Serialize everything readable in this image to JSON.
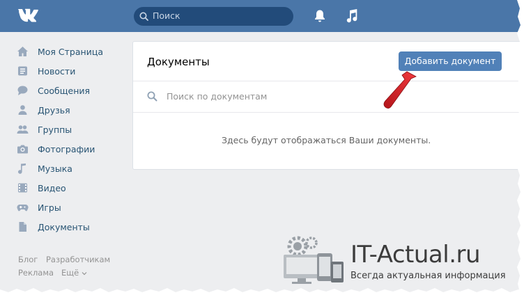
{
  "header": {
    "search_placeholder": "Поиск"
  },
  "sidebar": {
    "items": [
      {
        "label": "Моя Страница",
        "icon": "home-icon"
      },
      {
        "label": "Новости",
        "icon": "news-icon"
      },
      {
        "label": "Сообщения",
        "icon": "messages-icon"
      },
      {
        "label": "Друзья",
        "icon": "friends-icon"
      },
      {
        "label": "Группы",
        "icon": "groups-icon"
      },
      {
        "label": "Фотографии",
        "icon": "photos-icon"
      },
      {
        "label": "Музыка",
        "icon": "music-icon"
      },
      {
        "label": "Видео",
        "icon": "video-icon"
      },
      {
        "label": "Игры",
        "icon": "games-icon"
      },
      {
        "label": "Документы",
        "icon": "documents-icon"
      }
    ],
    "footer": {
      "blog": "Блог",
      "developers": "Разработчикам",
      "ads": "Реклама",
      "more": "Ещё"
    }
  },
  "main": {
    "title": "Документы",
    "add_button": "Добавить документ",
    "search_placeholder": "Поиск по документам",
    "empty_message": "Здесь будут отображаться Ваши документы."
  },
  "watermark": {
    "title": "IT-Actual.ru",
    "subtitle": "Всегда актуальная информация"
  },
  "colors": {
    "header_bg": "#4a76a8",
    "accent": "#5181b8",
    "arrow": "#e3262a"
  }
}
